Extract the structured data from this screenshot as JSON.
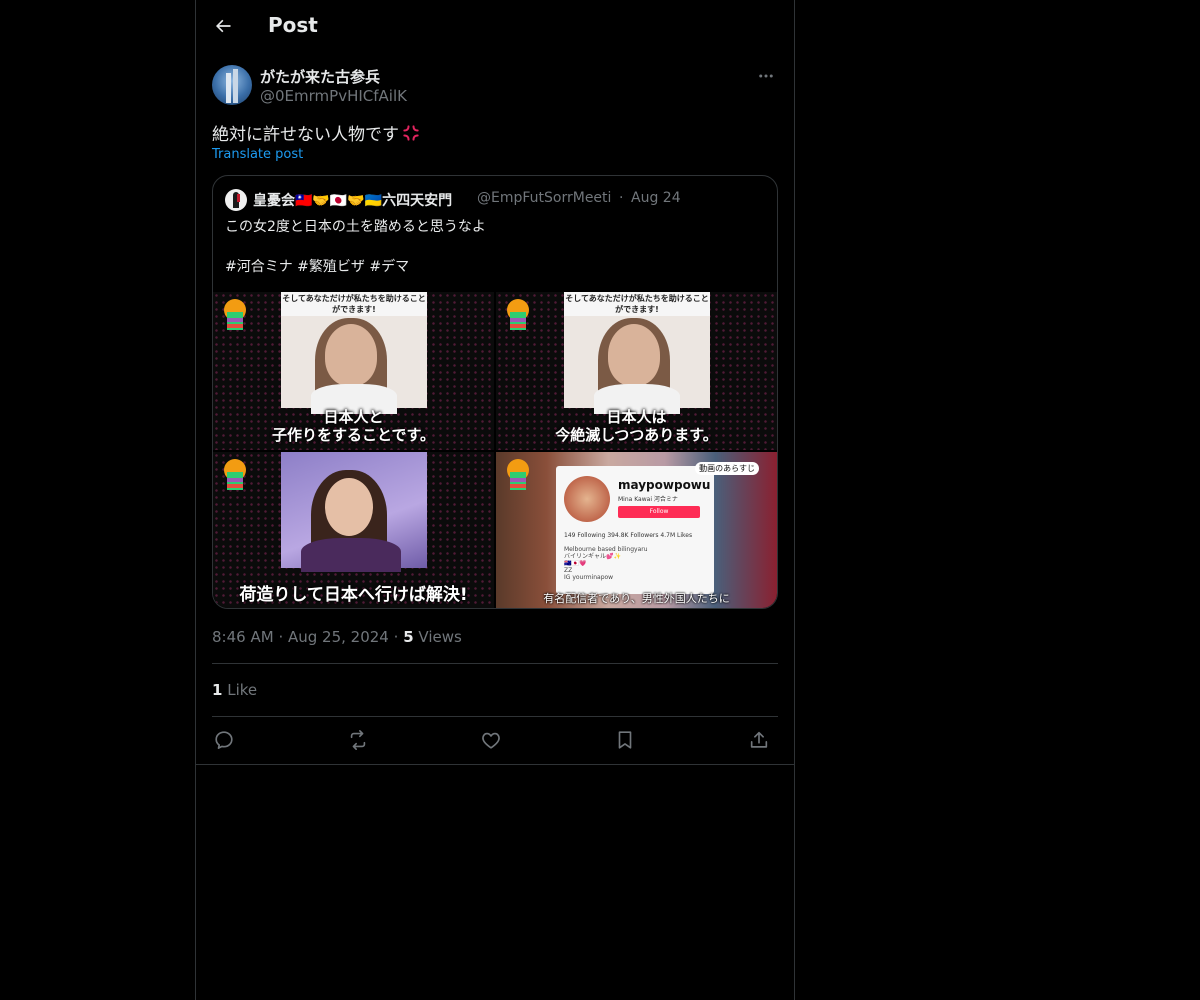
{
  "header": {
    "title": "Post"
  },
  "author": {
    "display_name": "がたが来た古参兵",
    "handle": "@0EmrmPvHICfAilK"
  },
  "post": {
    "text": "絶対に許せない人物です",
    "translate_label": "Translate post"
  },
  "quote": {
    "display_name": "皇憂会🇹🇼🤝🇯🇵🤝🇺🇦六四天安門",
    "handle": "@EmpFutSorrMeeti",
    "separator": "·",
    "date": "Aug 24",
    "text_line1": "この女2度と日本の土を踏めると思うなよ",
    "hashtags": "#河合ミナ #繁殖ビザ #デマ",
    "media": [
      {
        "banner": "そしてあなただけが私たちを助けることができます!",
        "caption_line1": "日本人と",
        "caption_line2": "子作りをすることです。"
      },
      {
        "banner": "そしてあなただけが私たちを助けることができます!",
        "caption_line1": "日本人は",
        "caption_line2": "今絶滅しつつあります。"
      },
      {
        "caption": "荷造りして日本へ行けば解決!"
      },
      {
        "profile_name": "maypowpowu",
        "profile_sub": "Mina Kawai 河合ミナ",
        "follow_label": "Follow",
        "stats": "149 Following  394.8K Followers  4.7M Likes",
        "bio": "Melbourne based bilingyaru\nバイリンギャル💕✨\n🇦🇺🇯🇵💗\nZZ\nIG yourminapow",
        "bubble": "動画のあらすじ",
        "caption": "有名配信者であり、男性外国人たちに"
      }
    ]
  },
  "meta": {
    "time": "8:46 AM",
    "sep1": "·",
    "date": "Aug 25, 2024",
    "sep2": "·",
    "views_count": "5",
    "views_label": "Views"
  },
  "likes": {
    "count": "1",
    "label": "Like"
  },
  "icons": [
    "back-arrow-icon",
    "more-icon",
    "anger-icon",
    "reply-icon",
    "repost-icon",
    "like-icon",
    "bookmark-icon",
    "share-icon"
  ]
}
